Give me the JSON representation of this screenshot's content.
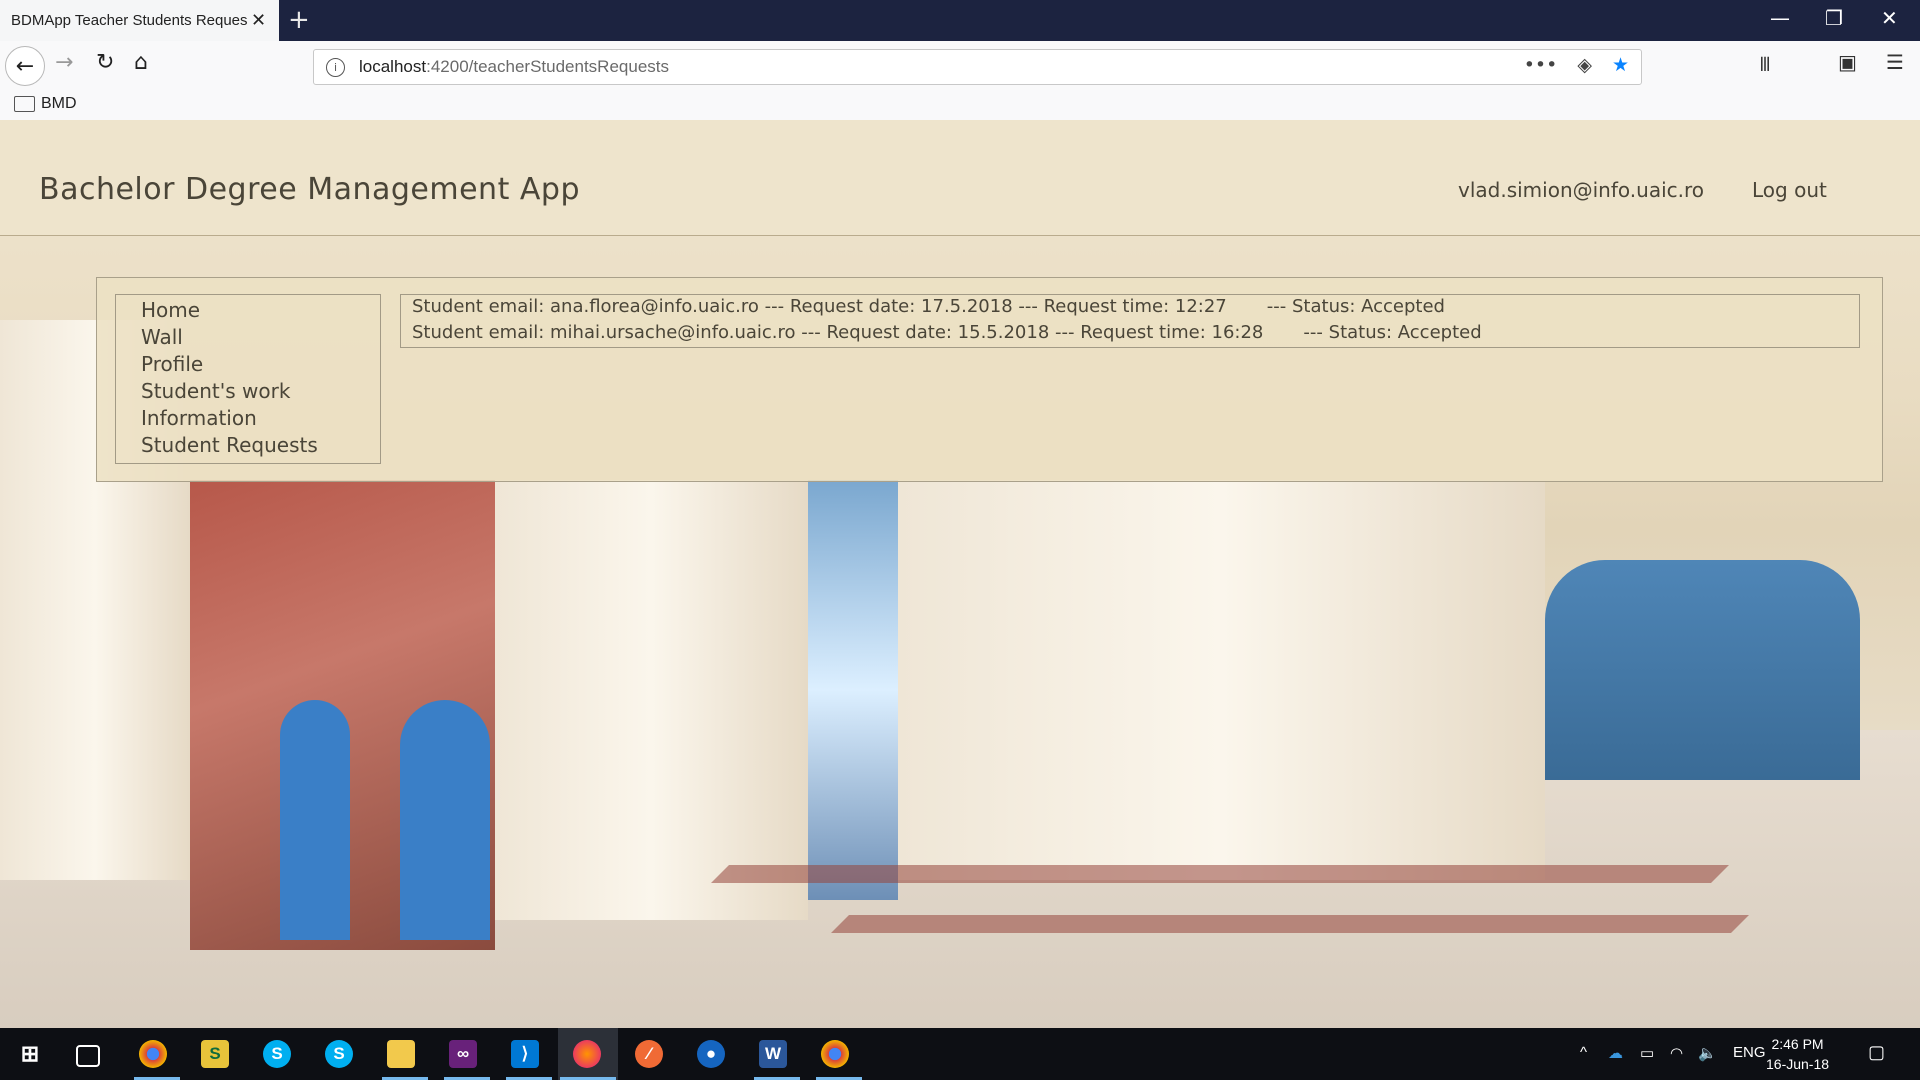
{
  "browser": {
    "tab_title": "BDMApp Teacher Students Requests",
    "tab_close": "✕",
    "new_tab": "+",
    "url_host": "localhost",
    "url_rest": ":4200/teacherStudentsRequests",
    "bookmark": "BMD",
    "window_controls": {
      "minimize": "—",
      "restore": "❐",
      "close": "✕"
    }
  },
  "header": {
    "title": "Bachelor Degree Management App",
    "user_email": "vlad.simion@info.uaic.ro",
    "logout": "Log out"
  },
  "menu": {
    "items": [
      {
        "label": "Home"
      },
      {
        "label": "Wall"
      },
      {
        "label": "Profile"
      },
      {
        "label": "Student's work"
      },
      {
        "label": "Information"
      },
      {
        "label": "Student Requests"
      }
    ]
  },
  "requests": [
    {
      "text": "Student email: ana.florea@info.uaic.ro --- Request date: 17.5.2018 --- Request time: 12:27       --- Status: Accepted"
    },
    {
      "text": "Student email: mihai.ursache@info.uaic.ro --- Request date: 15.5.2018 --- Request time: 16:28       --- Status: Accepted"
    }
  ],
  "taskbar": {
    "language": "ENG",
    "time": "2:46 PM",
    "date": "16-Jun-18"
  },
  "colors": {
    "tabbar": "#1c2340",
    "accent": "#0a84ff",
    "text": "#4a4538"
  }
}
